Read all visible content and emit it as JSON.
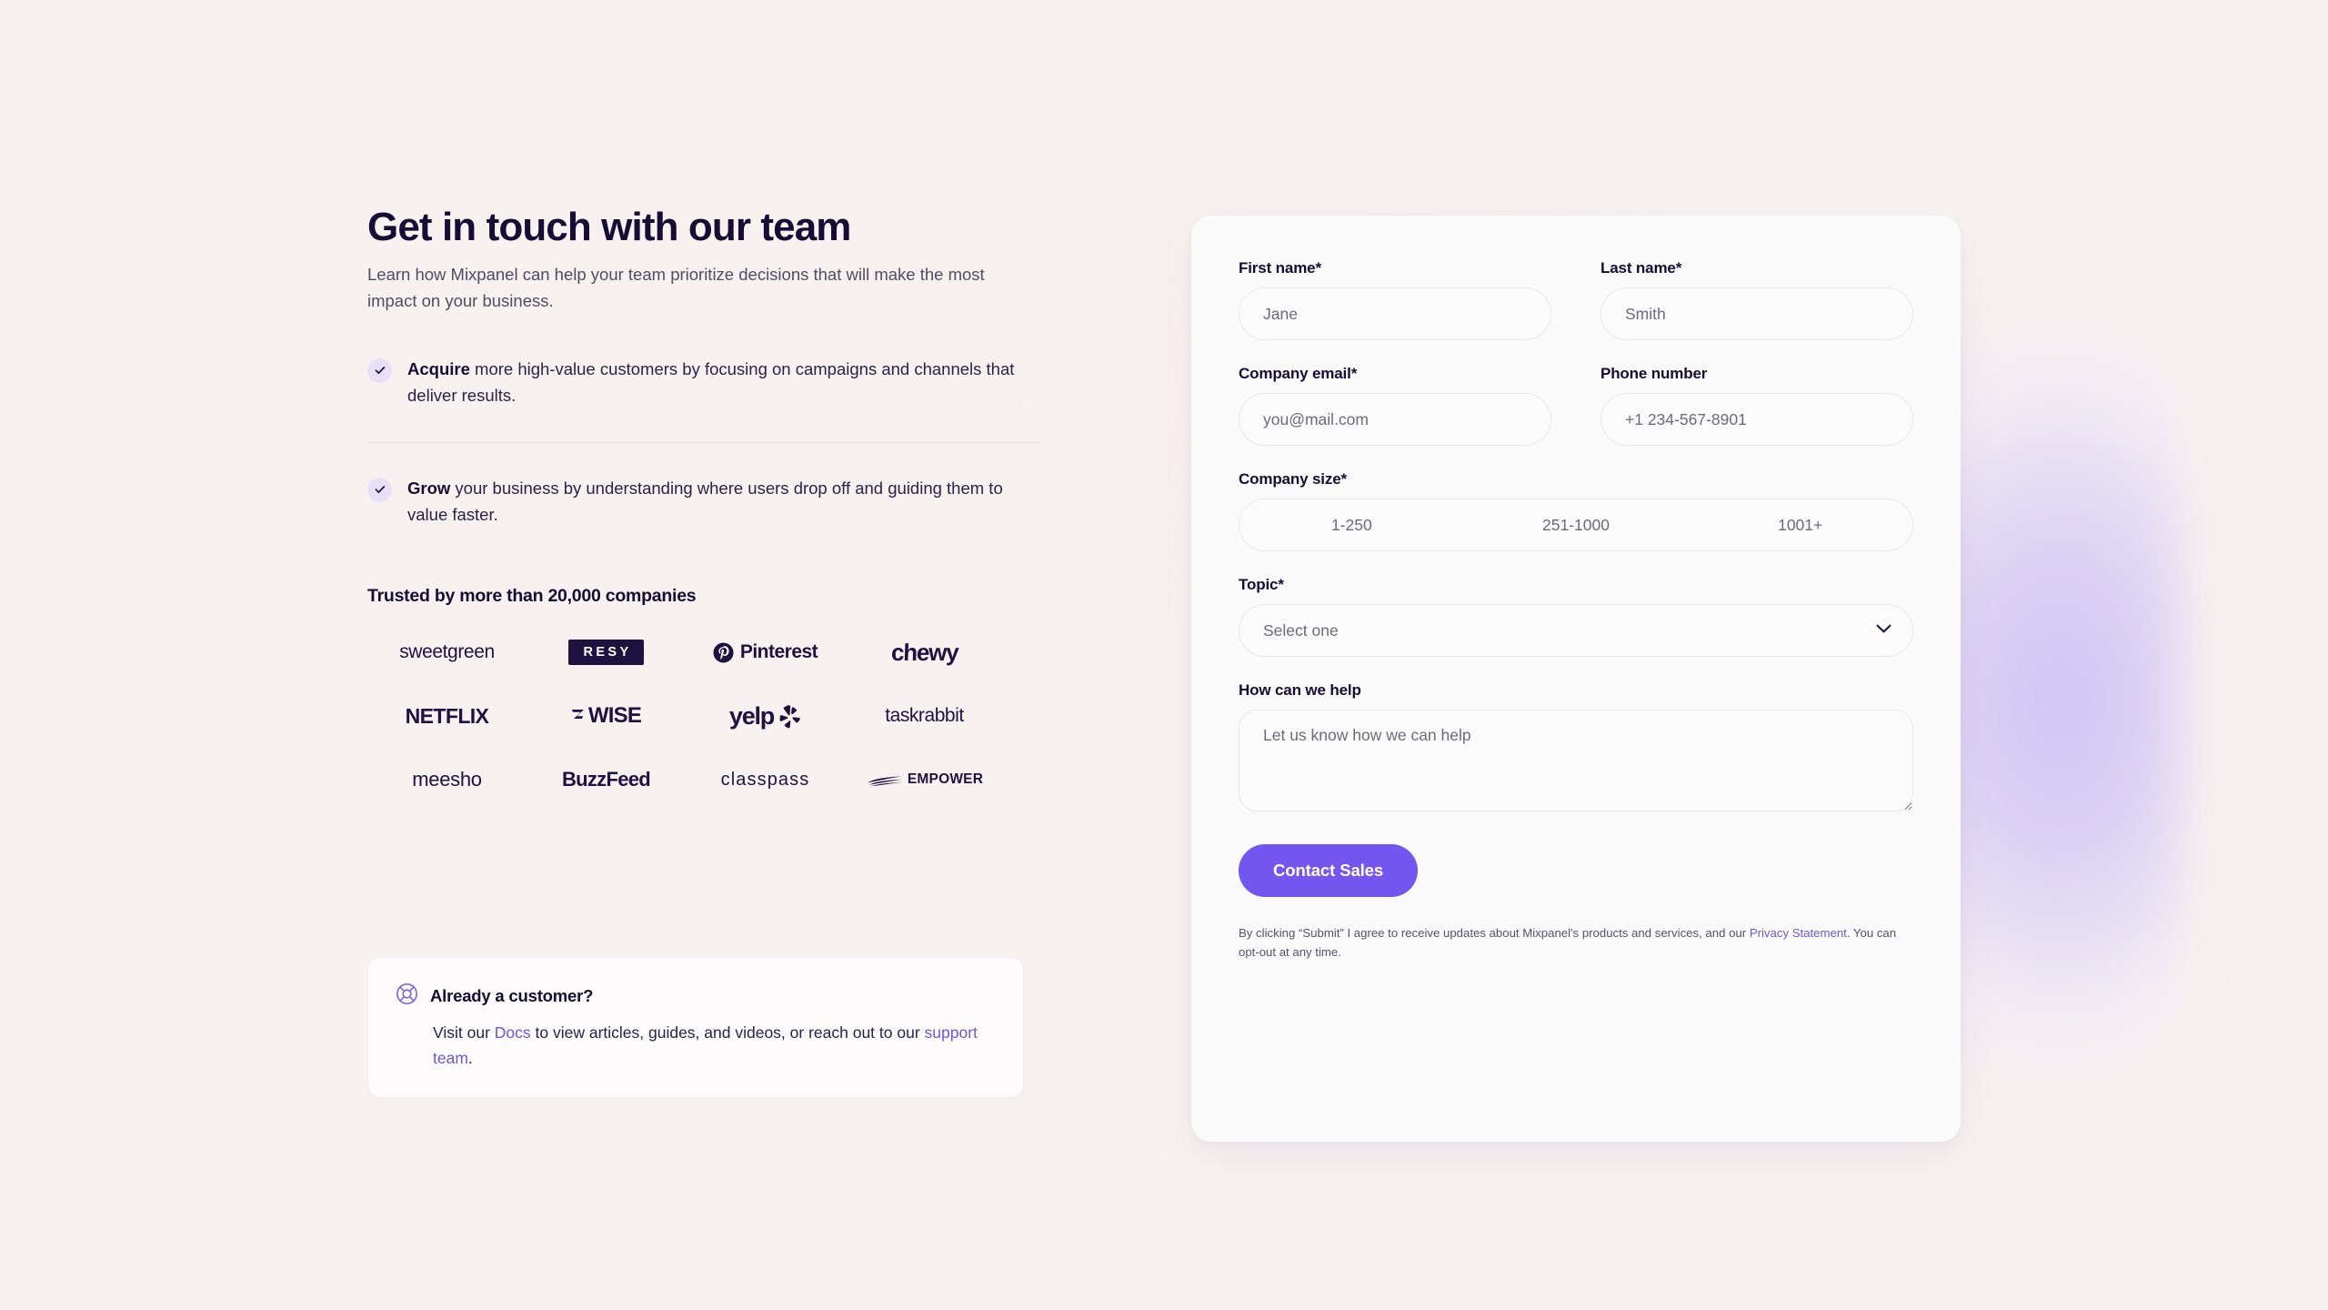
{
  "theme": {
    "page_bg": "#f7f1f0",
    "accent_purple": "#7355ef",
    "link_purple": "#6e56d8",
    "ink": "#150d33",
    "glow_lavender": "#cdc1f3",
    "card_bg": "#fbfafb"
  },
  "hero": {
    "headline": "Get in touch with our team",
    "subhead": "Learn how Mixpanel can help your team prioritize decisions that will make the most impact on your business."
  },
  "benefits": [
    {
      "icon": "check-icon",
      "bold": "Acquire",
      "rest": " more high-value customers by focusing on campaigns and channels that deliver results."
    },
    {
      "icon": "check-icon",
      "bold": "Grow",
      "rest": " your business by understanding where users drop off and guiding them to value faster."
    }
  ],
  "trusted": {
    "title": "Trusted by more than 20,000 companies",
    "logos": [
      {
        "name": "sweetgreen",
        "style": "lg-sweetgreen"
      },
      {
        "name": "RESY",
        "style": "lg-resy"
      },
      {
        "name": "Pinterest",
        "style": "lg-pinterest"
      },
      {
        "name": "chewy",
        "style": "lg-chewy"
      },
      {
        "name": "NETFLIX",
        "style": "lg-netflix"
      },
      {
        "name": "WISE",
        "style": "lg-wise"
      },
      {
        "name": "yelp",
        "style": "lg-yelp"
      },
      {
        "name": "taskrabbit",
        "style": "lg-taskrabbit"
      },
      {
        "name": "meesho",
        "style": "lg-meesho"
      },
      {
        "name": "BuzzFeed",
        "style": "lg-buzzfeed"
      },
      {
        "name": "classpass",
        "style": "lg-classpass"
      },
      {
        "name": "EMPOWER",
        "style": "lg-empower"
      }
    ]
  },
  "customer_card": {
    "icon": "lifebuoy-icon",
    "title": "Already a customer?",
    "body_pre": "Visit our ",
    "link_docs": "Docs",
    "body_mid": " to view articles, guides, and videos, or reach out to our ",
    "link_support": "support team",
    "body_end": "."
  },
  "form": {
    "first_name": {
      "label": "First name*",
      "placeholder": "Jane",
      "value": ""
    },
    "last_name": {
      "label": "Last name*",
      "placeholder": "Smith",
      "value": ""
    },
    "company_email": {
      "label": "Company email*",
      "placeholder": "you@mail.com",
      "value": ""
    },
    "phone": {
      "label": "Phone number",
      "placeholder": "+1 234-567-8901",
      "value": ""
    },
    "company_size": {
      "label": "Company size*",
      "options": [
        "1-250",
        "251-1000",
        "1001+"
      ],
      "selected": ""
    },
    "topic": {
      "label": "Topic*",
      "placeholder": "Select one",
      "selected": "Select one",
      "chevron": "chevron-down-icon"
    },
    "message": {
      "label": "How can we help",
      "placeholder": "Let us know how we can help",
      "value": "",
      "resize_handle": "resize-handle-icon"
    },
    "submit_label": "Contact Sales",
    "legal_pre": "By clicking “Submit” I agree to receive updates about Mixpanel's products and services, and our ",
    "legal_link": "Privacy Statement",
    "legal_post": ". You can opt-out at any time."
  }
}
